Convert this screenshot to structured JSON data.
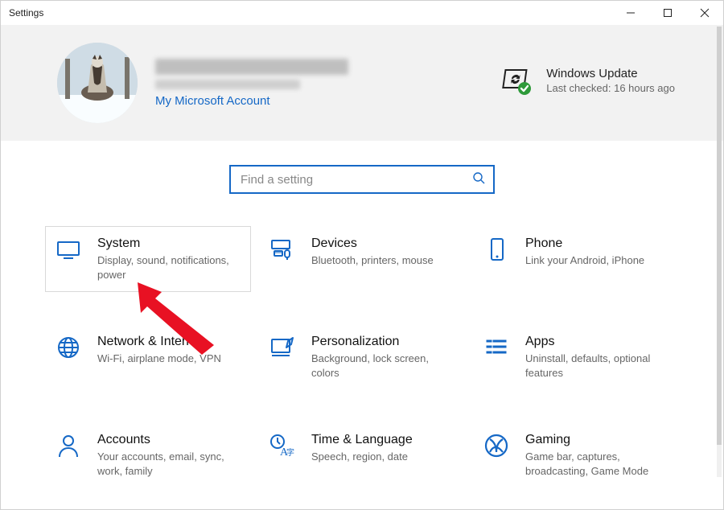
{
  "window": {
    "title": "Settings"
  },
  "user": {
    "msAccountLink": "My Microsoft Account"
  },
  "update": {
    "title": "Windows Update",
    "sub": "Last checked: 16 hours ago"
  },
  "search": {
    "placeholder": "Find a setting"
  },
  "tiles": {
    "system": {
      "title": "System",
      "sub": "Display, sound, notifications, power"
    },
    "devices": {
      "title": "Devices",
      "sub": "Bluetooth, printers, mouse"
    },
    "phone": {
      "title": "Phone",
      "sub": "Link your Android, iPhone"
    },
    "network": {
      "title": "Network & Internet",
      "sub": "Wi-Fi, airplane mode, VPN"
    },
    "personal": {
      "title": "Personalization",
      "sub": "Background, lock screen, colors"
    },
    "apps": {
      "title": "Apps",
      "sub": "Uninstall, defaults, optional features"
    },
    "accounts": {
      "title": "Accounts",
      "sub": "Your accounts, email, sync, work, family"
    },
    "time": {
      "title": "Time & Language",
      "sub": "Speech, region, date"
    },
    "gaming": {
      "title": "Gaming",
      "sub": "Game bar, captures, broadcasting, Game Mode"
    }
  },
  "colors": {
    "accent": "#1568c6"
  }
}
